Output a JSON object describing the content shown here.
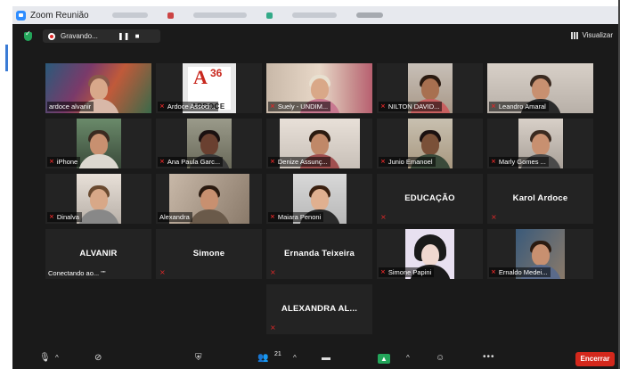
{
  "window": {
    "title": "Zoom Reunião"
  },
  "topbar": {
    "recording_label": "Gravando...",
    "pause_symbol": "❚❚",
    "stop_symbol": "■",
    "view_label": "Visualizar"
  },
  "participants": [
    {
      "name": "ardoce alvanir",
      "muted": false,
      "active": true
    },
    {
      "name": "Ardoce Associ...",
      "muted": true,
      "logo_text": "ARDOCE",
      "logo_letter": "A",
      "logo_number": "36"
    },
    {
      "name": "Suely - UNDIM...",
      "muted": true
    },
    {
      "name": "NILTON DAVID...",
      "muted": true
    },
    {
      "name": "Leandro Amaral",
      "muted": true
    },
    {
      "name": "iPhone",
      "muted": true
    },
    {
      "name": "Ana Paula Garc...",
      "muted": true
    },
    {
      "name": "Denize Assunç...",
      "muted": true
    },
    {
      "name": "Junio Emanoel",
      "muted": true
    },
    {
      "name": "Marly Gomes ...",
      "muted": true
    },
    {
      "name": "Dinalva",
      "muted": true
    },
    {
      "name": "Alexandra",
      "muted": false
    },
    {
      "name": "Maiara Penoni",
      "muted": true
    },
    {
      "name": "EDUCAÇÃO",
      "muted": true
    },
    {
      "name": "Karol Ardoce",
      "muted": true
    },
    {
      "name": "ALVANIR",
      "status": "Conectando ao... \"\""
    },
    {
      "name": "Simone",
      "muted": true
    },
    {
      "name": "Ernanda Teixeira",
      "muted": true
    },
    {
      "name": "Simone Papini",
      "muted": true
    },
    {
      "name": "Ernaldo Medei...",
      "muted": true
    },
    {
      "name": "ALEXANDRA AL...",
      "muted": true
    }
  ],
  "toolbar": {
    "participant_count": "21",
    "end_label": "Encerrar",
    "share_symbol": "▲",
    "more_symbol": "•••"
  }
}
